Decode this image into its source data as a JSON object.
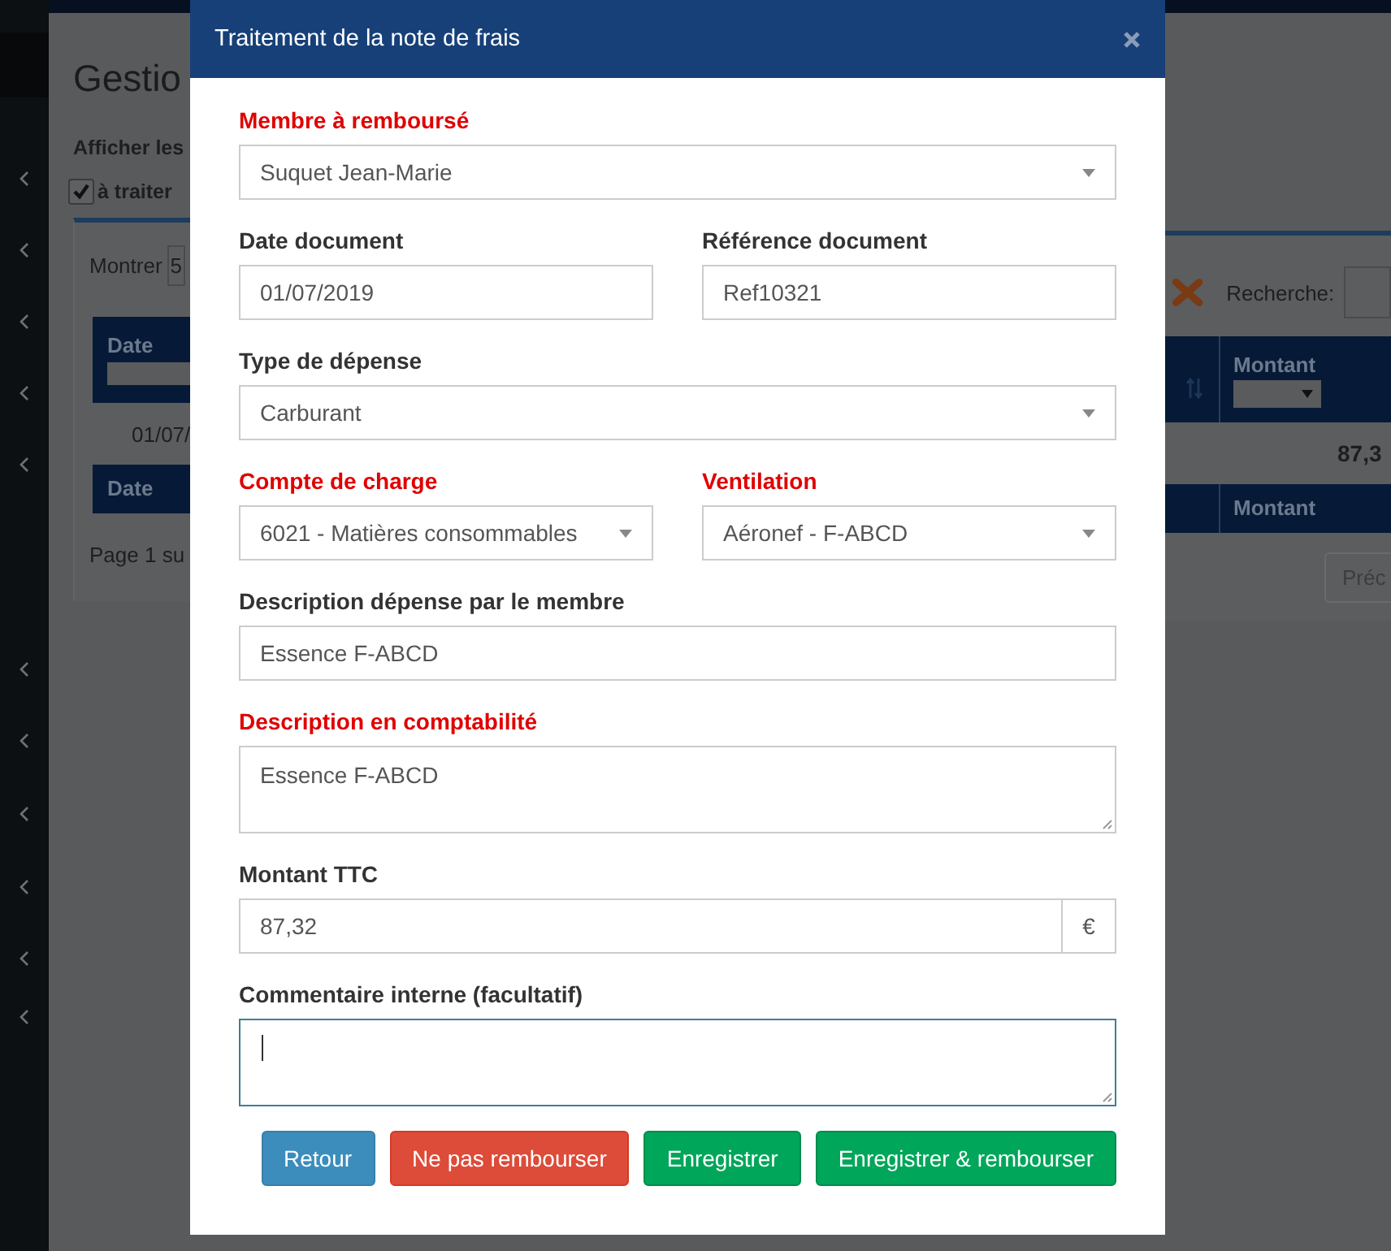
{
  "background": {
    "page_title": "Gestio",
    "filter_label": "Afficher les",
    "filter_checkbox": {
      "label": "à traiter",
      "checked": true
    },
    "show_label": "Montrer",
    "show_value": "5",
    "search_label": "Recherche:",
    "header_left": "Date",
    "header_right": "Montant",
    "row_date": "01/07/",
    "row_amount": "87,3",
    "footer_left": "Date",
    "footer_right": "Montant",
    "page_info": "Page 1 su",
    "prev_button": "Préc"
  },
  "modal": {
    "title": "Traitement de la note de frais",
    "rows": [
      [
        {
          "label": "Membre à remboursé",
          "required": true,
          "kind": "select",
          "value": "Suquet Jean-Marie"
        }
      ],
      [
        {
          "label": "Date document",
          "required": false,
          "kind": "input",
          "value": "01/07/2019"
        },
        {
          "label": "Référence document",
          "required": false,
          "kind": "input",
          "value": "Ref10321"
        }
      ],
      [
        {
          "label": "Type de dépense",
          "required": false,
          "kind": "select",
          "value": "Carburant"
        }
      ],
      [
        {
          "label": "Compte de charge",
          "required": true,
          "kind": "select",
          "value": "6021 - Matières consommables"
        },
        {
          "label": "Ventilation",
          "required": true,
          "kind": "select",
          "value": "Aéronef - F-ABCD"
        }
      ],
      [
        {
          "label": "Description dépense par le membre",
          "required": false,
          "kind": "input",
          "value": "Essence F-ABCD"
        }
      ],
      [
        {
          "label": "Description en comptabilité",
          "required": true,
          "kind": "textarea",
          "value": "Essence F-ABCD",
          "focused": false
        }
      ],
      [
        {
          "label": "Montant TTC",
          "required": false,
          "kind": "addon",
          "value": "87,32",
          "addon": "€"
        }
      ],
      [
        {
          "label": "Commentaire interne (facultatif)",
          "required": false,
          "kind": "textarea",
          "focused": true
        }
      ]
    ],
    "buttons": [
      {
        "label": "Retour",
        "kind": "info"
      },
      {
        "label": "Ne pas rembourser",
        "kind": "danger"
      },
      {
        "label": "Enregistrer",
        "kind": "success"
      },
      {
        "label": "Enregistrer & rembourser",
        "kind": "success"
      }
    ]
  }
}
